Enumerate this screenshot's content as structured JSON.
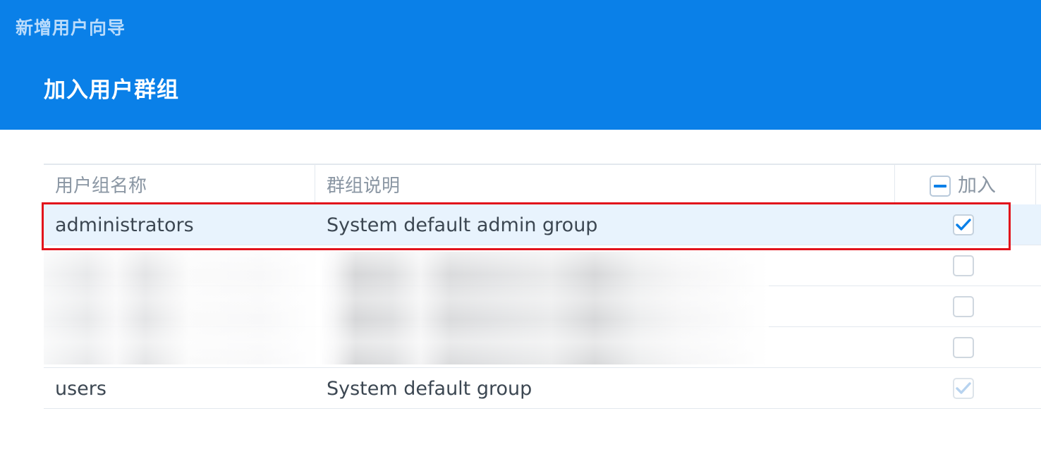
{
  "wizard": {
    "title": "新增用户向导",
    "step_title": "加入用户群组"
  },
  "table": {
    "columns": {
      "name": "用户组名称",
      "description": "群组说明",
      "join": "加入"
    },
    "header_checkbox_state": "partial",
    "rows": [
      {
        "name": "administrators",
        "description": "System default admin group",
        "checked": true,
        "selected": true,
        "disabled": false
      },
      {
        "name": "",
        "description": "",
        "checked": false,
        "selected": false,
        "disabled": false,
        "redacted": true
      },
      {
        "name": "",
        "description": "",
        "checked": false,
        "selected": false,
        "disabled": false,
        "redacted": true
      },
      {
        "name": "",
        "description": "",
        "checked": false,
        "selected": false,
        "disabled": false,
        "redacted": true
      },
      {
        "name": "users",
        "description": "System default group",
        "checked": true,
        "selected": false,
        "disabled": true
      }
    ]
  },
  "colors": {
    "header_bg": "#0a80e8",
    "check_active": "#0a80e8",
    "check_disabled": "#b7d3ef",
    "highlight_border": "#e2121b",
    "selected_row_bg": "#e8f3fd"
  },
  "icons": {
    "checkmark": "check-icon",
    "partial": "minus-icon"
  }
}
